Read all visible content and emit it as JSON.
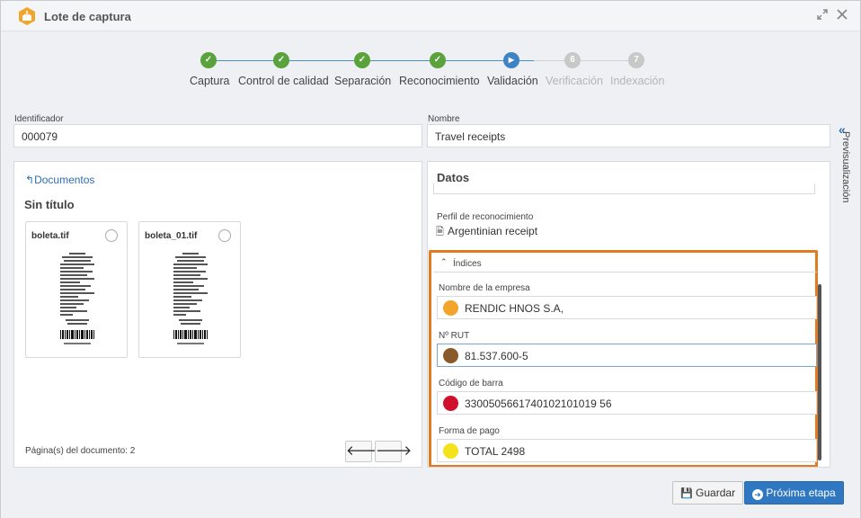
{
  "window": {
    "title": "Lote de captura"
  },
  "stepper": {
    "steps": [
      {
        "label": "Captura",
        "state": "done",
        "marker": "✓"
      },
      {
        "label": "Control de calidad",
        "state": "done",
        "marker": "✓"
      },
      {
        "label": "Separación",
        "state": "done",
        "marker": "✓"
      },
      {
        "label": "Reconocimiento",
        "state": "done",
        "marker": "✓"
      },
      {
        "label": "Validación",
        "state": "active",
        "marker": "▶"
      },
      {
        "label": "Verificación",
        "state": "pending",
        "marker": "6"
      },
      {
        "label": "Indexación",
        "state": "pending",
        "marker": "7"
      }
    ]
  },
  "fields": {
    "identificador_label": "Identificador",
    "identificador_value": "000079",
    "nombre_label": "Nombre",
    "nombre_value": "Travel receipts"
  },
  "side_tab": {
    "label": "Previsualización"
  },
  "documents": {
    "back_link": "Documentos",
    "title": "Sin título",
    "files": [
      "boleta.tif",
      "boleta_01.tif"
    ],
    "pages_text": "Página(s) del documento: 2"
  },
  "datos": {
    "title": "Datos",
    "profile_label": "Perfil de reconocimiento",
    "profile_value": "Argentinian receipt",
    "indices_title": "Índices",
    "indices": [
      {
        "label": "Nombre de la empresa",
        "value": "RENDIC HNOS S.A,",
        "color": "#f2a52a"
      },
      {
        "label": "Nº RUT",
        "value": "81.537.600-5",
        "color": "#8b5a2b"
      },
      {
        "label": "Código de barra",
        "value": "3300505661740102101019 56",
        "color": "#d0112b"
      },
      {
        "label": "Forma de pago",
        "value": "TOTAL 2498",
        "color": "#f5e21a"
      }
    ]
  },
  "buttons": {
    "save": "Guardar",
    "next": "Próxima etapa"
  },
  "colors": {
    "highlight": "#e07b1f",
    "accent": "#2f77c1",
    "done": "#5aa23b"
  }
}
